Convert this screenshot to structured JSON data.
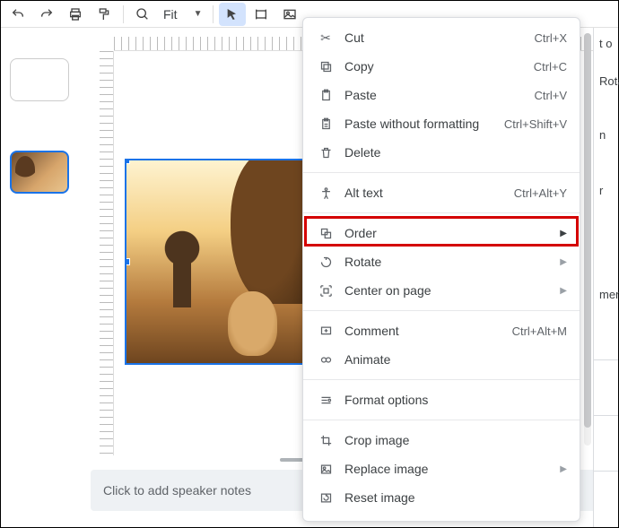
{
  "toolbar": {
    "zoom_label": "Fit"
  },
  "context_menu": {
    "cut": "Cut",
    "cut_sc": "Ctrl+X",
    "copy": "Copy",
    "copy_sc": "Ctrl+C",
    "paste": "Paste",
    "paste_sc": "Ctrl+V",
    "paste_nf": "Paste without formatting",
    "paste_nf_sc": "Ctrl+Shift+V",
    "delete": "Delete",
    "alt_text": "Alt text",
    "alt_text_sc": "Ctrl+Alt+Y",
    "order": "Order",
    "rotate": "Rotate",
    "center": "Center on page",
    "comment": "Comment",
    "comment_sc": "Ctrl+Alt+M",
    "animate": "Animate",
    "format_options": "Format options",
    "crop": "Crop image",
    "replace": "Replace image",
    "reset": "Reset image"
  },
  "speaker_notes_placeholder": "Click to add speaker notes",
  "right_panel": {
    "label_top": "t o",
    "rotation": "Rota",
    "n": "n",
    "r": "r",
    "men": "men"
  }
}
